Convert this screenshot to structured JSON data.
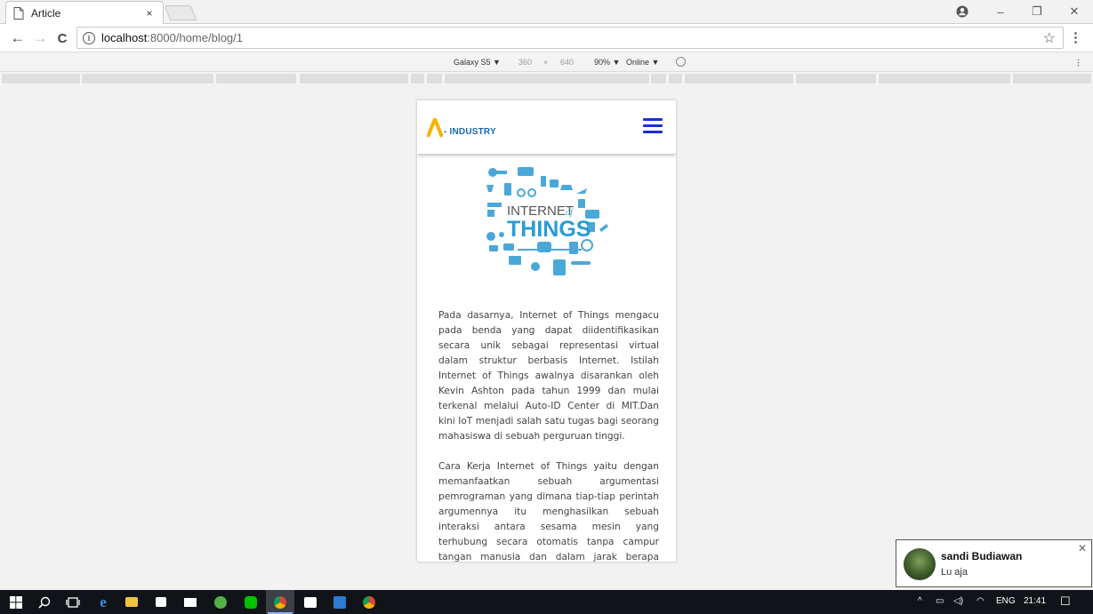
{
  "browser": {
    "tab": {
      "title": "Article",
      "close": "×"
    },
    "window_controls": {
      "account": "account-icon",
      "minimize": "–",
      "restore": "❐",
      "close": "✕"
    },
    "nav": {
      "back": "←",
      "forward": "→",
      "reload": "C"
    },
    "omnibox": {
      "info": "i",
      "host": "localhost",
      "rest": ":8000/home/blog/1"
    },
    "bookmark": "☆",
    "menu": "⋮"
  },
  "device_toolbar": {
    "device": "Galaxy S5 ▼",
    "width": "360",
    "times": "×",
    "height": "640",
    "zoom": "90% ▼",
    "network": "Online ▼",
    "menu": "⋮"
  },
  "site": {
    "logo_text": "- INDUSTRY",
    "logo_color": "#f4b400",
    "brand_color": "#1b2fd6",
    "image": {
      "top": "INTERNET",
      "of": "of",
      "bottom": "THINGS"
    },
    "article": {
      "paragraphs": [
        "Pada dasarnya, Internet of Things mengacu pada benda yang dapat diidentifikasikan secara unik sebagai representasi virtual dalam struktur berbasis Internet. Istilah Internet of Things awalnya disarankan oleh Kevin Ashton pada tahun 1999 dan mulai terkenal melalui Auto-ID Center di MIT.Dan kini IoT menjadi salah satu tugas bagi seorang mahasiswa di sebuah perguruan tinggi.",
        "Cara Kerja Internet of Things yaitu dengan memanfaatkan sebuah argumentasi pemrograman yang dimana tiap-tiap perintah argumennya itu menghasilkan sebuah interaksi antara sesama mesin yang terhubung secara otomatis tanpa campur tangan manusia dan dalam jarak berapa pun.Internetlah yang"
      ]
    }
  },
  "notification": {
    "name": "sandi Budiawan",
    "message": "Lu aja",
    "close": "✕"
  },
  "taskbar": {
    "tray": {
      "chevron": "^",
      "language": "ENG",
      "time": "21:41"
    }
  }
}
